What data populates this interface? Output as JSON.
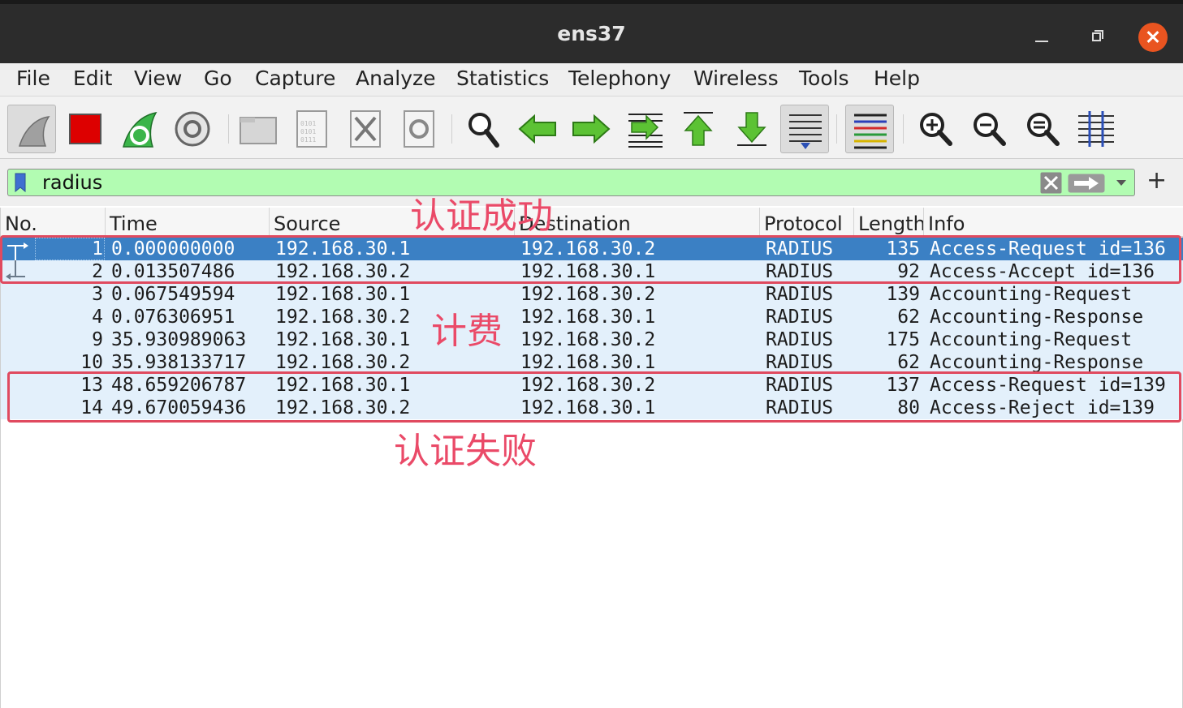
{
  "window": {
    "title": "ens37"
  },
  "menu": [
    "File",
    "Edit",
    "View",
    "Go",
    "Capture",
    "Analyze",
    "Statistics",
    "Telephony",
    "Wireless",
    "Tools",
    "Help"
  ],
  "toolbar": {
    "icons": [
      "shark-fin-start-icon",
      "stop-capture-icon",
      "restart-capture-icon",
      "capture-options-icon",
      "open-file-icon",
      "save-file-icon",
      "close-file-icon",
      "reload-file-icon",
      "find-packet-icon",
      "go-back-icon",
      "go-forward-icon",
      "go-to-packet-icon",
      "first-packet-icon",
      "last-packet-icon",
      "autoscroll-icon",
      "colorize-icon",
      "zoom-in-icon",
      "zoom-out-icon",
      "normal-size-icon",
      "resize-columns-icon"
    ],
    "colors": {
      "stop": "#dd0000",
      "arrow": "#4caf2e",
      "shark": "#9c9c9c"
    }
  },
  "filter": {
    "value": "radius",
    "background": "#b2fcb2"
  },
  "packet_list": {
    "columns": [
      "No.",
      "Time",
      "Source",
      "Destination",
      "Protocol",
      "Length",
      "Info"
    ],
    "rows": [
      {
        "no": "1",
        "time": "0.000000000",
        "source": "192.168.30.1",
        "destination": "192.168.30.2",
        "protocol": "RADIUS",
        "length": "135",
        "info": "Access-Request id=136",
        "selected": true
      },
      {
        "no": "2",
        "time": "0.013507486",
        "source": "192.168.30.2",
        "destination": "192.168.30.1",
        "protocol": "RADIUS",
        "length": "92",
        "info": "Access-Accept id=136",
        "selected": false
      },
      {
        "no": "3",
        "time": "0.067549594",
        "source": "192.168.30.1",
        "destination": "192.168.30.2",
        "protocol": "RADIUS",
        "length": "139",
        "info": "Accounting-Request",
        "selected": false
      },
      {
        "no": "4",
        "time": "0.076306951",
        "source": "192.168.30.2",
        "destination": "192.168.30.1",
        "protocol": "RADIUS",
        "length": "62",
        "info": "Accounting-Response",
        "selected": false
      },
      {
        "no": "9",
        "time": "35.930989063",
        "source": "192.168.30.1",
        "destination": "192.168.30.2",
        "protocol": "RADIUS",
        "length": "175",
        "info": "Accounting-Request",
        "selected": false
      },
      {
        "no": "10",
        "time": "35.938133717",
        "source": "192.168.30.2",
        "destination": "192.168.30.1",
        "protocol": "RADIUS",
        "length": "62",
        "info": "Accounting-Response",
        "selected": false
      },
      {
        "no": "13",
        "time": "48.659206787",
        "source": "192.168.30.1",
        "destination": "192.168.30.2",
        "protocol": "RADIUS",
        "length": "137",
        "info": "Access-Request id=139",
        "selected": false
      },
      {
        "no": "14",
        "time": "49.670059436",
        "source": "192.168.30.2",
        "destination": "192.168.30.1",
        "protocol": "RADIUS",
        "length": "80",
        "info": "Access-Reject id=139",
        "selected": false
      }
    ],
    "row_color": "#e3f0fb",
    "selected_color": "#3b80c4"
  },
  "annotations": {
    "success": "认证成功",
    "accounting": "计费",
    "failure": "认证失败",
    "color": "#e04a5f"
  }
}
